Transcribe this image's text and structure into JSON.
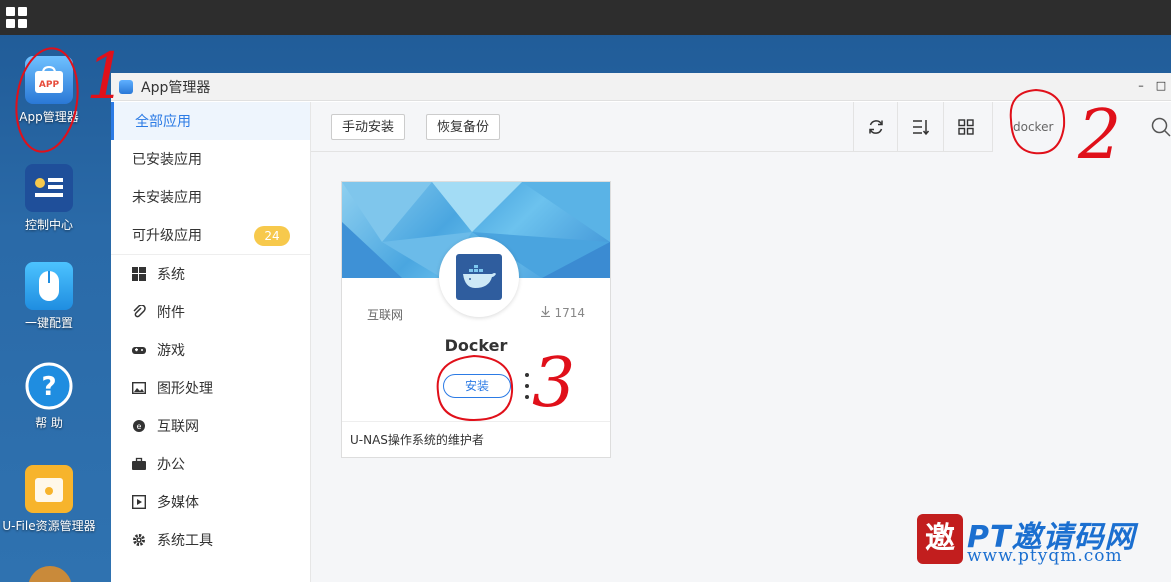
{
  "desktop": {
    "icons": [
      {
        "label": "App管理器"
      },
      {
        "label": "控制中心"
      },
      {
        "label": "一键配置"
      },
      {
        "label": "帮 助"
      },
      {
        "label": "U-File资源管理器"
      }
    ]
  },
  "window": {
    "title": "App管理器",
    "controls": {
      "minimize": "–",
      "maximize": "□"
    }
  },
  "sidebar": {
    "primary": [
      {
        "label": "全部应用",
        "active": true
      },
      {
        "label": "已安装应用"
      },
      {
        "label": "未安装应用"
      },
      {
        "label": "可升级应用",
        "badge": "24"
      }
    ],
    "categories": [
      {
        "label": "系统",
        "icon": "windows-icon"
      },
      {
        "label": "附件",
        "icon": "paperclip-icon"
      },
      {
        "label": "游戏",
        "icon": "gamepad-icon"
      },
      {
        "label": "图形处理",
        "icon": "image-icon"
      },
      {
        "label": "互联网",
        "icon": "globe-icon"
      },
      {
        "label": "办公",
        "icon": "briefcase-icon"
      },
      {
        "label": "多媒体",
        "icon": "play-icon"
      },
      {
        "label": "系统工具",
        "icon": "gear-icon"
      }
    ]
  },
  "toolbar": {
    "manual_install": "手动安装",
    "restore_backup": "恢复备份",
    "search_value": "docker"
  },
  "card": {
    "category": "互联网",
    "downloads": "1714",
    "name": "Docker",
    "install": "安装",
    "description": "U-NAS操作系统的维护者"
  },
  "annotations": {
    "one": "1",
    "two": "2",
    "three": "3"
  },
  "watermark": {
    "seal": "邀",
    "title": "PT邀请码网",
    "url": "www.ptyqm.com"
  },
  "colors": {
    "accent": "#2c7be5",
    "badge": "#f7c94c",
    "annotation": "#e0101a"
  }
}
